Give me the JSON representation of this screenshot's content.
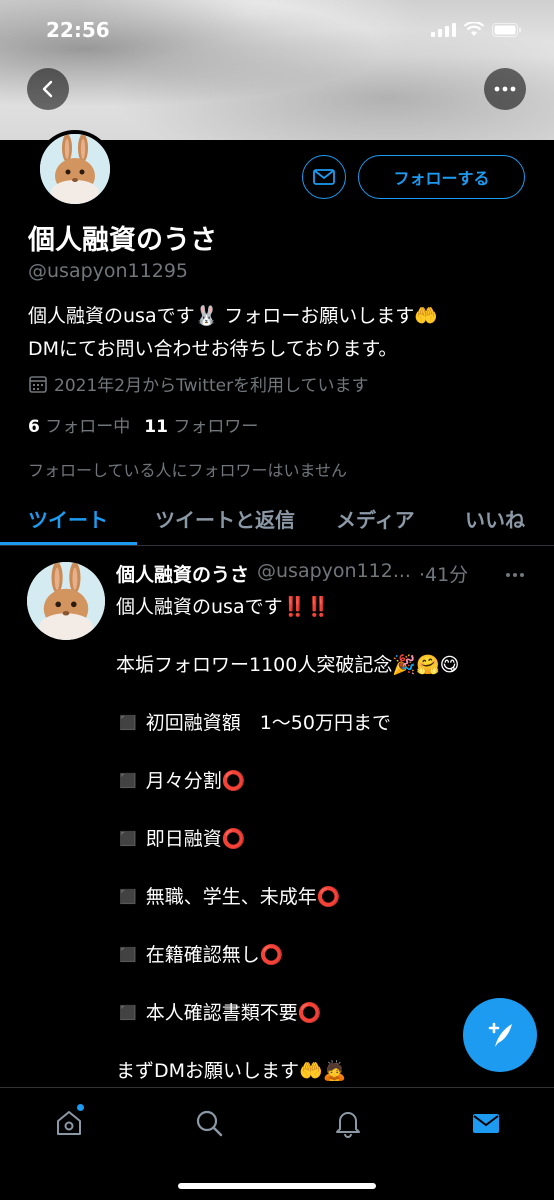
{
  "status_bar": {
    "time": "22:56"
  },
  "profile": {
    "display_name": "個人融資のうさ",
    "handle": "@usapyon11295",
    "follow_button_label": "フォローする",
    "bio_line1": "個人融資のusaです🐰 フォローお願いします🤲",
    "bio_line2": "DMにてお問い合わせお待ちしております。",
    "joined": "2021年2月からTwitterを利用しています",
    "following_count": "6",
    "following_label": "フォロー中",
    "followers_count": "11",
    "followers_label": "フォロワー",
    "followers_note": "フォローしている人にフォロワーはいません"
  },
  "tabs": [
    {
      "label": "ツイート",
      "active": true
    },
    {
      "label": "ツイートと返信",
      "active": false
    },
    {
      "label": "メディア",
      "active": false
    },
    {
      "label": "いいね",
      "active": false
    }
  ],
  "tweet": {
    "name": "個人融資のうさ",
    "handle": "@usapyon112...",
    "time": "·41分",
    "lines": [
      "個人融資のusaです‼️‼️",
      "本垢フォロワー1100人突破記念🎉🤗😋",
      "◼️ 初回融資額　1〜50万円まで",
      "◼️ 月々分割⭕",
      "◼️ 即日融資⭕",
      "◼️ 無職、学生、未成年⭕",
      "◼️ 在籍確認無し⭕",
      "◼️ 本人確認書類不要⭕",
      "まずDMお願いします🤲🙇"
    ]
  },
  "colors": {
    "accent": "#1d9bf0",
    "secondary_text": "#71767b",
    "background": "#000000"
  },
  "icons": {
    "back": "back-arrow-icon",
    "more": "more-horizontal-icon",
    "dm": "envelope-icon",
    "calendar": "calendar-icon",
    "compose": "compose-tweet-icon",
    "nav": [
      "home-icon",
      "search-icon",
      "notifications-bell-icon",
      "messages-icon"
    ]
  }
}
